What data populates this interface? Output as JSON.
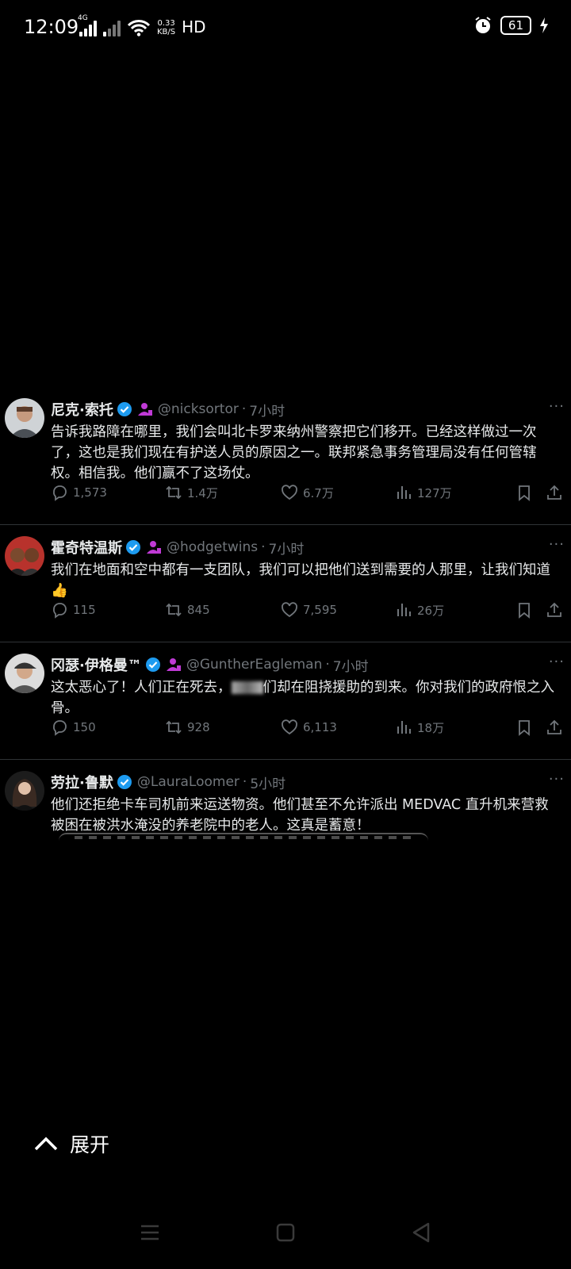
{
  "status_bar": {
    "time": "12:09",
    "network_tag": "4G",
    "net_speed_value": "0.33",
    "net_speed_unit": "KB/S",
    "hd_label": "HD",
    "battery": "61",
    "icons": [
      "signal-icon",
      "signal-off-icon",
      "wifi-icon",
      "alarm-icon",
      "charging-icon"
    ]
  },
  "tweets": [
    {
      "name": "尼克·索托",
      "handle": "@nicksortor",
      "dot": "·",
      "time": "7小时",
      "text": "告诉我路障在哪里，我们会叫北卡罗来纳州警察把它们移开。已经这样做过一次了，这也是我们现在有护送人员的原因之一。联邦紧急事务管理局没有任何管辖权。相信我。他们赢不了这场仗。",
      "replies": "1,573",
      "retweets": "1.4万",
      "likes": "6.7万",
      "views": "127万"
    },
    {
      "name": "霍奇特温斯",
      "handle": "@hodgetwins",
      "dot": "·",
      "time": "7小时",
      "text": "我们在地面和空中都有一支团队，我们可以把他们送到需要的人那里，让我们知道👍",
      "replies": "115",
      "retweets": "845",
      "likes": "7,595",
      "views": "26万"
    },
    {
      "name": "冈瑟·伊格曼™",
      "handle": "@GuntherEagleman",
      "dot": "·",
      "time": "7小时",
      "text_before": "这太恶心了！人们正在死去，",
      "text_after": "们却在阻挠援助的到来。你对我们的政府恨之入骨。",
      "replies": "150",
      "retweets": "928",
      "likes": "6,113",
      "views": "18万"
    },
    {
      "name": "劳拉·鲁默",
      "handle": "@LauraLoomer",
      "dot": "·",
      "time": "5小时",
      "text": "他们还拒绝卡车司机前来运送物资。他们甚至不允许派出 MEDVAC 直升机来营救被困在被洪水淹没的养老院中的老人。这真是蓄意！"
    }
  ],
  "more_label": "···",
  "expand_label": "展开",
  "colors": {
    "background": "#000000",
    "text": "#e7e9ea",
    "muted": "#71767b",
    "verified": "#1d9bf0",
    "affiliate": "#c03ad6",
    "divider": "#2f3336"
  }
}
